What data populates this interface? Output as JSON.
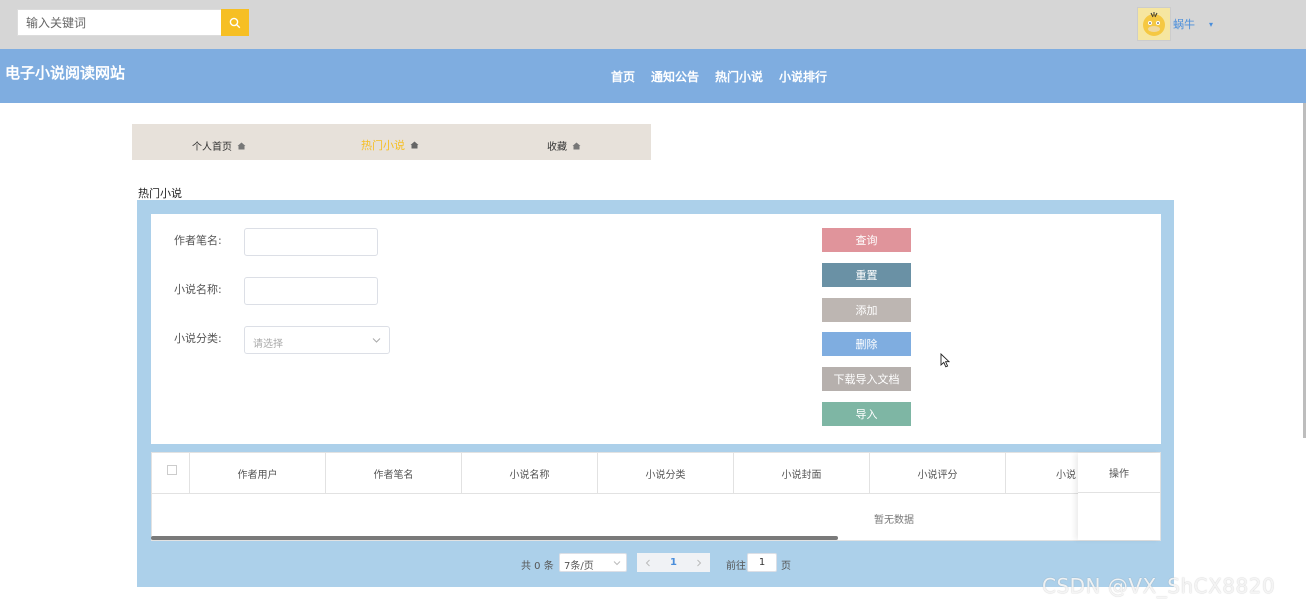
{
  "topbar": {
    "search_placeholder": "输入关键词",
    "user_name": "蜗牛",
    "caret": "▾"
  },
  "header": {
    "site_title": "电子小说阅读网站",
    "nav": [
      "首页",
      "通知公告",
      "热门小说",
      "小说排行"
    ]
  },
  "subnav": {
    "items": [
      "个人首页",
      "热门小说",
      "收藏"
    ],
    "active": "热门小说"
  },
  "page": {
    "section_title": "热门小说"
  },
  "form": {
    "author_pen_name_label": "作者笔名:",
    "novel_name_label": "小说名称:",
    "novel_category_label": "小说分类:",
    "category_placeholder": "请选择"
  },
  "buttons": {
    "query": "查询",
    "reset": "重置",
    "add": "添加",
    "delete": "删除",
    "download_template": "下载导入文档",
    "import": "导入"
  },
  "colors": {
    "query": "#e0949b",
    "reset": "#6a91a5",
    "add": "#bdb6b2",
    "delete": "#7fade0",
    "download_template": "#b6b0ad",
    "import": "#7eb6a4",
    "accent": "#f6bf24"
  },
  "table": {
    "columns": [
      "作者用户",
      "作者笔名",
      "小说名称",
      "小说分类",
      "小说封面",
      "小说评分",
      "小说"
    ],
    "action_column": "操作",
    "empty_text": "暂无数据"
  },
  "pagination": {
    "total": "共 0 条",
    "page_size": "7条/页",
    "current_page": "1",
    "goto_label": "前往",
    "goto_value": "1",
    "page_suffix": "页"
  },
  "watermark": "CSDN @VX_ShCX8820"
}
